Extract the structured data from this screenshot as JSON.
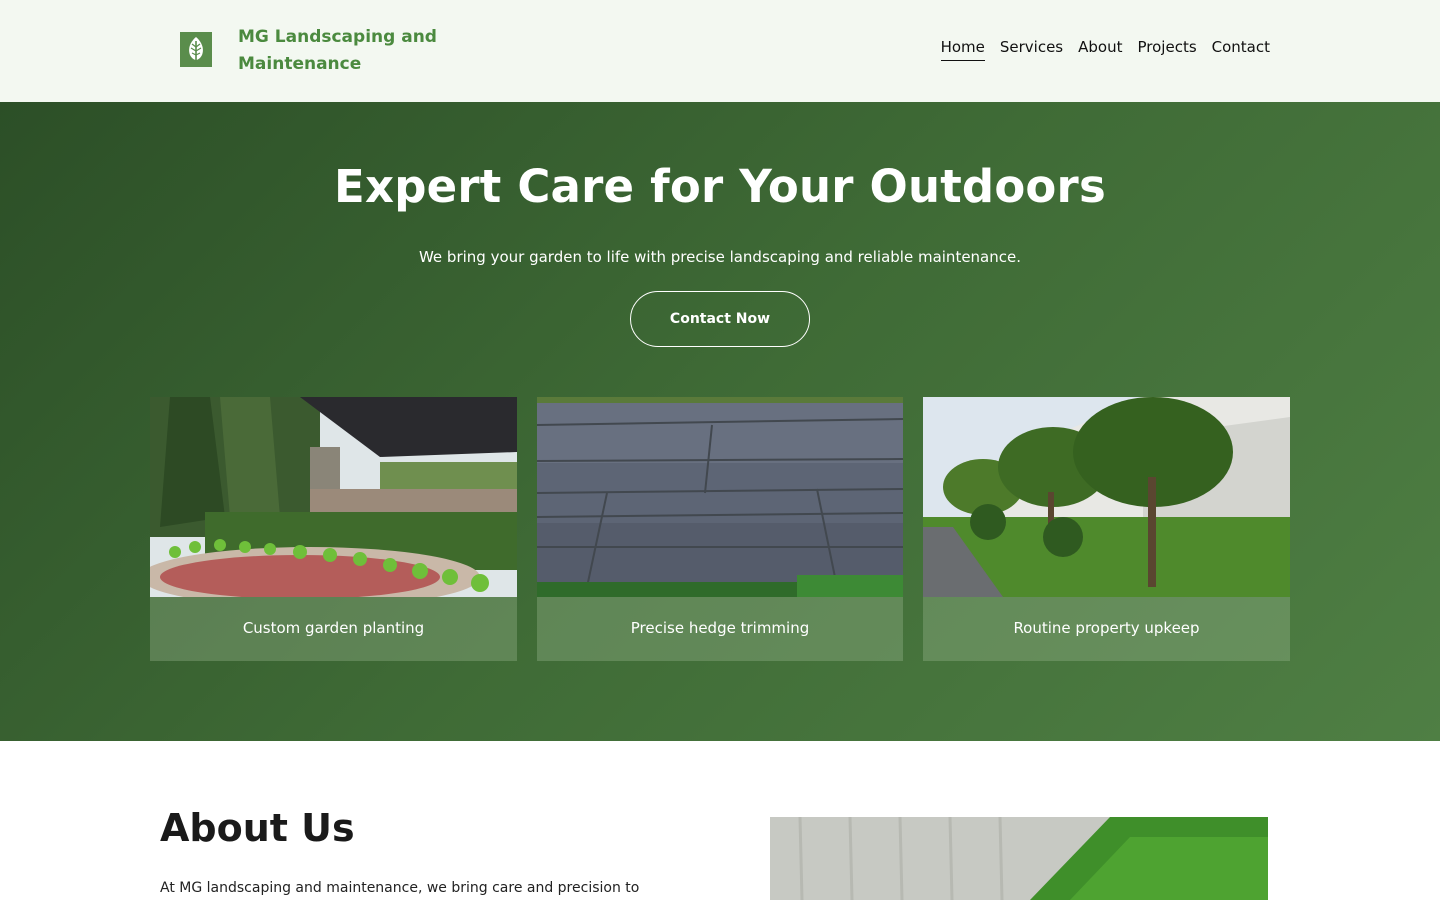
{
  "header": {
    "brand_name": "MG Landscaping and Maintenance",
    "logo_icon": "leaf-icon",
    "nav": [
      {
        "label": "Home",
        "active": true
      },
      {
        "label": "Services",
        "active": false
      },
      {
        "label": "About",
        "active": false
      },
      {
        "label": "Projects",
        "active": false
      },
      {
        "label": "Contact",
        "active": false
      }
    ]
  },
  "hero": {
    "title": "Expert Care for Your Outdoors",
    "subtitle": "We bring your garden to life with precise landscaping and reliable maintenance.",
    "cta_label": "Contact Now",
    "cards": [
      {
        "caption": "Custom garden planting",
        "image": "garden-planting-photo"
      },
      {
        "caption": "Precise hedge trimming",
        "image": "stone-pavement-photo"
      },
      {
        "caption": "Routine property upkeep",
        "image": "trees-building-photo"
      }
    ]
  },
  "about": {
    "title": "About Us",
    "text": "At MG landscaping and maintenance, we bring care and precision to"
  },
  "colors": {
    "header_bg": "#f3f8f1",
    "brand_green": "#4b8a3f",
    "hero_dark": "#2c4f27",
    "hero_light": "#4f7f44"
  }
}
